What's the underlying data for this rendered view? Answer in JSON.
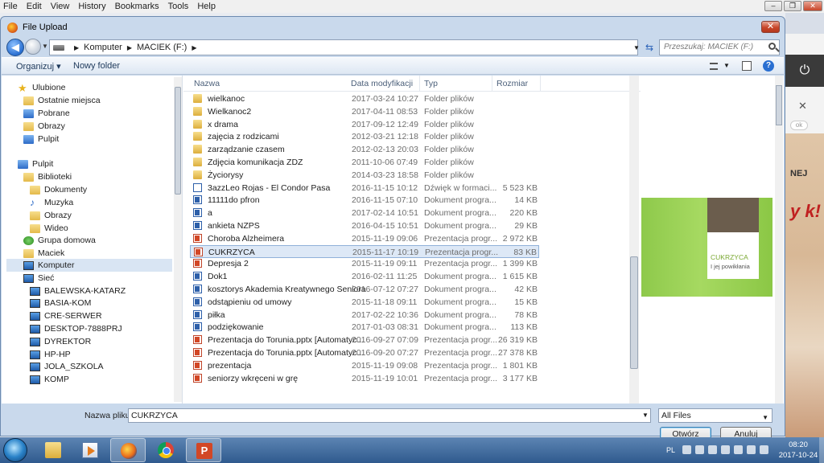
{
  "browser_menu": [
    "File",
    "Edit",
    "View",
    "History",
    "Bookmarks",
    "Tools",
    "Help"
  ],
  "window_controls": {
    "minimize": "–",
    "restore": "❐",
    "close": "✕"
  },
  "right_behind": {
    "power_icon": "⏻",
    "close_ad": "✕",
    "pill": "ok",
    "ad_text1": "NEJ",
    "ad_text2": "y\nk!"
  },
  "dialog": {
    "title": "File Upload",
    "close_label": "✕",
    "address": {
      "path": [
        "Komputer",
        "MACIEK (F:)"
      ]
    },
    "search_placeholder": "Przeszukaj: MACIEK (F:)",
    "toolbar": {
      "organize": "Organizuj ▾",
      "new_folder": "Nowy folder",
      "help": "?"
    },
    "nav": [
      {
        "label": "Ulubione",
        "icon": "star-icon",
        "level": 0
      },
      {
        "label": "Ostatnie miejsca",
        "icon": "recent-places-icon",
        "level": 1
      },
      {
        "label": "Pobrane",
        "icon": "downloads-icon",
        "level": 1
      },
      {
        "label": "Obrazy",
        "icon": "pictures-icon",
        "level": 1
      },
      {
        "label": "Pulpit",
        "icon": "desktop-icon",
        "level": 1
      },
      {
        "label": "",
        "icon": "",
        "level": -1
      },
      {
        "label": "Pulpit",
        "icon": "desktop-icon",
        "level": 0
      },
      {
        "label": "Biblioteki",
        "icon": "libraries-icon",
        "level": 1
      },
      {
        "label": "Dokumenty",
        "icon": "documents-icon",
        "level": 2
      },
      {
        "label": "Muzyka",
        "icon": "music-icon",
        "level": 2
      },
      {
        "label": "Obrazy",
        "icon": "pictures-icon",
        "level": 2
      },
      {
        "label": "Wideo",
        "icon": "video-icon",
        "level": 2
      },
      {
        "label": "Grupa domowa",
        "icon": "homegroup-icon",
        "level": 1
      },
      {
        "label": "Maciek",
        "icon": "user-folder-icon",
        "level": 1
      },
      {
        "label": "Komputer",
        "icon": "computer-icon",
        "level": 1,
        "selected": true
      },
      {
        "label": "Sieć",
        "icon": "network-icon",
        "level": 1
      },
      {
        "label": "BALEWSKA-KATARZ",
        "icon": "network-computer-icon",
        "level": 2
      },
      {
        "label": "BASIA-KOM",
        "icon": "network-computer-icon",
        "level": 2
      },
      {
        "label": "CRE-SERWER",
        "icon": "network-computer-icon",
        "level": 2
      },
      {
        "label": "DESKTOP-7888PRJ",
        "icon": "network-computer-icon",
        "level": 2
      },
      {
        "label": "DYREKTOR",
        "icon": "network-computer-icon",
        "level": 2
      },
      {
        "label": "HP-HP",
        "icon": "network-computer-icon",
        "level": 2
      },
      {
        "label": "JOLA_SZKOLA",
        "icon": "network-computer-icon",
        "level": 2
      },
      {
        "label": "KOMP",
        "icon": "network-computer-icon",
        "level": 2
      }
    ],
    "columns": {
      "name": "Nazwa",
      "date": "Data modyfikacji",
      "type": "Typ",
      "size": "Rozmiar"
    },
    "files": [
      {
        "name": "wielkanoc",
        "date": "2017-03-24 10:27",
        "type": "Folder plików",
        "size": "",
        "icon": "folder"
      },
      {
        "name": "Wielkanoc2",
        "date": "2017-04-11 08:53",
        "type": "Folder plików",
        "size": "",
        "icon": "folder"
      },
      {
        "name": "x drama",
        "date": "2017-09-12 12:49",
        "type": "Folder plików",
        "size": "",
        "icon": "folder"
      },
      {
        "name": "zajęcia z rodzicami",
        "date": "2012-03-21 12:18",
        "type": "Folder plików",
        "size": "",
        "icon": "folder"
      },
      {
        "name": "zarządzanie czasem",
        "date": "2012-02-13 20:03",
        "type": "Folder plików",
        "size": "",
        "icon": "folder"
      },
      {
        "name": "Zdjęcia komunikacja ZDZ",
        "date": "2011-10-06 07:49",
        "type": "Folder plików",
        "size": "",
        "icon": "folder"
      },
      {
        "name": "Życiorysy",
        "date": "2014-03-23 18:58",
        "type": "Folder plików",
        "size": "",
        "icon": "folder"
      },
      {
        "name": "3azzLeo Rojas - El Condor Pasa",
        "date": "2016-11-15 10:12",
        "type": "Dźwięk w formaci...",
        "size": "5 523 KB",
        "icon": "audio"
      },
      {
        "name": "11111do pfron",
        "date": "2016-11-15 07:10",
        "type": "Dokument progra...",
        "size": "14 KB",
        "icon": "doc"
      },
      {
        "name": "a",
        "date": "2017-02-14 10:51",
        "type": "Dokument progra...",
        "size": "220 KB",
        "icon": "doc"
      },
      {
        "name": "ankieta NZPS",
        "date": "2016-04-15 10:51",
        "type": "Dokument progra...",
        "size": "29 KB",
        "icon": "doc"
      },
      {
        "name": "Choroba Alzheimera",
        "date": "2015-11-19 09:06",
        "type": "Prezentacja progr...",
        "size": "2 972 KB",
        "icon": "ppt"
      },
      {
        "name": "CUKRZYCA",
        "date": "2015-11-17 10:19",
        "type": "Prezentacja progr...",
        "size": "83 KB",
        "icon": "ppt",
        "selected": true
      },
      {
        "name": "Depresja 2",
        "date": "2015-11-19 09:11",
        "type": "Prezentacja progr...",
        "size": "1 399 KB",
        "icon": "ppt"
      },
      {
        "name": "Dok1",
        "date": "2016-02-11 11:25",
        "type": "Dokument progra...",
        "size": "1 615 KB",
        "icon": "doc"
      },
      {
        "name": "kosztorys Akademia Kreatywnego Seniora",
        "date": "2016-07-12 07:27",
        "type": "Dokument progra...",
        "size": "42 KB",
        "icon": "doc"
      },
      {
        "name": "odstąpieniu od umowy",
        "date": "2015-11-18 09:11",
        "type": "Dokument progra...",
        "size": "15 KB",
        "icon": "doc"
      },
      {
        "name": "piłka",
        "date": "2017-02-22 10:36",
        "type": "Dokument progra...",
        "size": "78 KB",
        "icon": "doc"
      },
      {
        "name": "podziękowanie",
        "date": "2017-01-03 08:31",
        "type": "Dokument progra...",
        "size": "113 KB",
        "icon": "doc"
      },
      {
        "name": "Prezentacja do Torunia.pptx [Automatyc...",
        "date": "2016-09-27 07:09",
        "type": "Prezentacja progr...",
        "size": "26 319 KB",
        "icon": "ppt"
      },
      {
        "name": "Prezentacja do Torunia.pptx [Automatyc...",
        "date": "2016-09-20 07:27",
        "type": "Prezentacja progr...",
        "size": "27 378 KB",
        "icon": "ppt"
      },
      {
        "name": "prezentacja",
        "date": "2015-11-19 09:08",
        "type": "Prezentacja progr...",
        "size": "1 801 KB",
        "icon": "ppt"
      },
      {
        "name": "seniorzy wkręceni w grę",
        "date": "2015-11-19 10:01",
        "type": "Prezentacja progr...",
        "size": "3 177 KB",
        "icon": "ppt"
      }
    ],
    "preview": {
      "slide_title": "CUKRZYCA",
      "slide_subtitle": "I jej powikłania"
    },
    "filename_label": "Nazwa pliku:",
    "filename_value": "CUKRZYCA",
    "filter_value": "All Files",
    "open_button": "Otwórz",
    "cancel_button": "Anuluj"
  },
  "taskbar": {
    "apps": [
      {
        "name": "explorer",
        "active": false
      },
      {
        "name": "media-player",
        "active": false
      },
      {
        "name": "firefox",
        "active": true
      },
      {
        "name": "chrome",
        "active": false
      },
      {
        "name": "powerpoint",
        "active": true
      }
    ],
    "language": "PL",
    "time": "08:20",
    "date": "2017-10-24"
  }
}
